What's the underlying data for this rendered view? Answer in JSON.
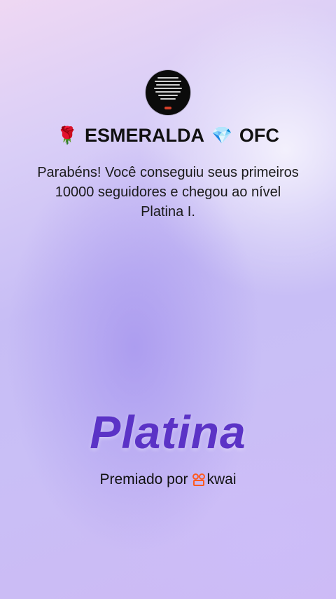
{
  "profile": {
    "name_prefix_emoji": "🌹",
    "name_main": "ESMERALDA",
    "name_gem_emoji": "💎",
    "name_suffix": "OFC"
  },
  "message": "Parabéns! Você conseguiu seus primeiros 10000 seguidores e chegou ao nível Platina I.",
  "level": {
    "title": "Platina",
    "color": "#5b33c6"
  },
  "award": {
    "label": "Premiado por",
    "brand": "kwai",
    "brand_icon": "kwai-logo-icon",
    "brand_color": "#ff5a1f"
  }
}
